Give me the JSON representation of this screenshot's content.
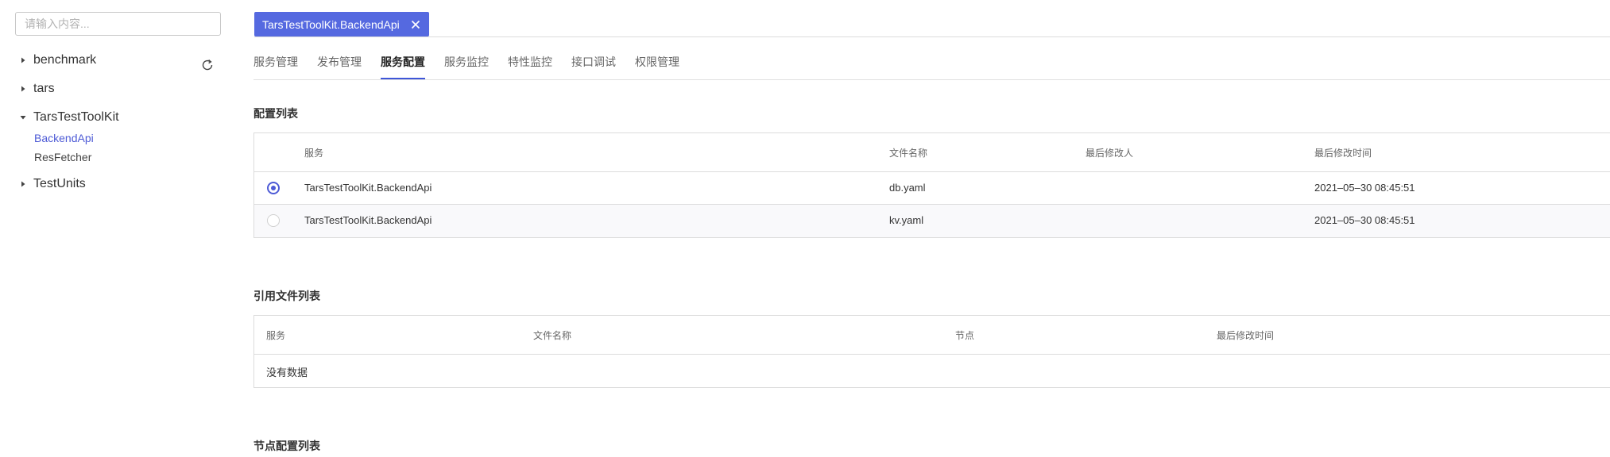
{
  "sidebar": {
    "search": {
      "placeholder": "请输入内容..."
    },
    "tree": [
      {
        "label": "benchmark",
        "expanded": false
      },
      {
        "label": "tars",
        "expanded": false
      },
      {
        "label": "TarsTestToolKit",
        "expanded": true,
        "children": [
          {
            "label": "BackendApi",
            "active": true
          },
          {
            "label": "ResFetcher",
            "active": false
          }
        ]
      },
      {
        "label": "TestUnits",
        "expanded": false
      }
    ]
  },
  "page_tab": {
    "title": "TarsTestToolKit.BackendApi"
  },
  "subnav": {
    "items": [
      {
        "label": "服务管理"
      },
      {
        "label": "发布管理"
      },
      {
        "label": "服务配置",
        "active": true
      },
      {
        "label": "服务监控"
      },
      {
        "label": "特性监控"
      },
      {
        "label": "接口调试"
      },
      {
        "label": "权限管理"
      }
    ]
  },
  "config_list": {
    "title": "配置列表",
    "columns": [
      "服务",
      "文件名称",
      "最后修改人",
      "最后修改时间"
    ],
    "rows": [
      {
        "selected": true,
        "service": "TarsTestToolKit.BackendApi",
        "filename": "db.yaml",
        "modifier": "",
        "modified_time": "2021–05–30 08:45:51"
      },
      {
        "selected": false,
        "service": "TarsTestToolKit.BackendApi",
        "filename": "kv.yaml",
        "modifier": "",
        "modified_time": "2021–05–30 08:45:51"
      }
    ]
  },
  "ref_list": {
    "title": "引用文件列表",
    "columns": [
      "服务",
      "文件名称",
      "节点",
      "最后修改时间"
    ],
    "empty_text": "没有数据"
  },
  "node_config": {
    "title": "节点配置列表"
  },
  "colors": {
    "accent": "#5569e0",
    "active_link": "#4e5bd6"
  }
}
